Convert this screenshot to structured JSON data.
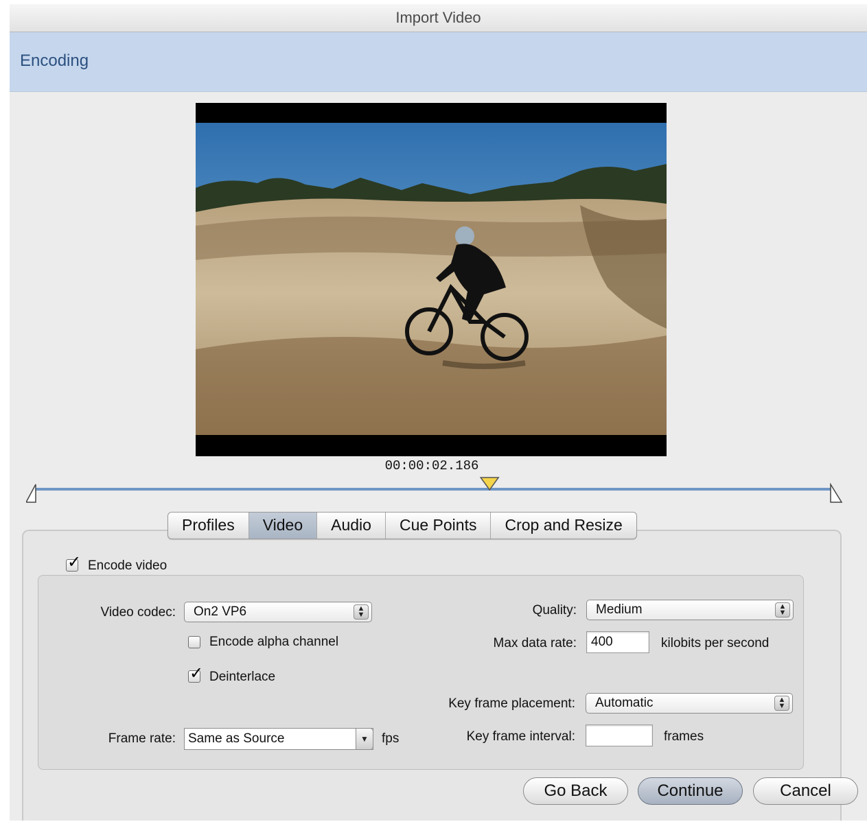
{
  "window": {
    "title": "Import Video"
  },
  "banner": {
    "step": "Encoding"
  },
  "preview": {
    "timecode": "00:00:02.186",
    "playhead_position": 0.57
  },
  "tabs": [
    {
      "label": "Profiles",
      "active": false
    },
    {
      "label": "Video",
      "active": true
    },
    {
      "label": "Audio",
      "active": false
    },
    {
      "label": "Cue Points",
      "active": false
    },
    {
      "label": "Crop and Resize",
      "active": false
    }
  ],
  "video": {
    "encode_video": {
      "label": "Encode video",
      "checked": true
    },
    "codec": {
      "label": "Video codec:",
      "value": "On2 VP6"
    },
    "alpha": {
      "label": "Encode alpha channel",
      "checked": false
    },
    "deinterlace": {
      "label": "Deinterlace",
      "checked": true
    },
    "frame_rate": {
      "label": "Frame rate:",
      "value": "Same as Source",
      "unit": "fps"
    },
    "quality": {
      "label": "Quality:",
      "value": "Medium"
    },
    "max_data_rate": {
      "label": "Max data rate:",
      "value": "400",
      "unit": "kilobits per second"
    },
    "key_frame_placement": {
      "label": "Key frame placement:",
      "value": "Automatic"
    },
    "key_frame_interval": {
      "label": "Key frame interval:",
      "value": "",
      "unit": "frames"
    }
  },
  "buttons": {
    "go_back": "Go Back",
    "continue": "Continue",
    "cancel": "Cancel"
  },
  "icons": {
    "checkmark": "checkmark-icon",
    "popup_arrows": "updown-arrows-icon",
    "playhead": "playhead-marker-icon"
  }
}
